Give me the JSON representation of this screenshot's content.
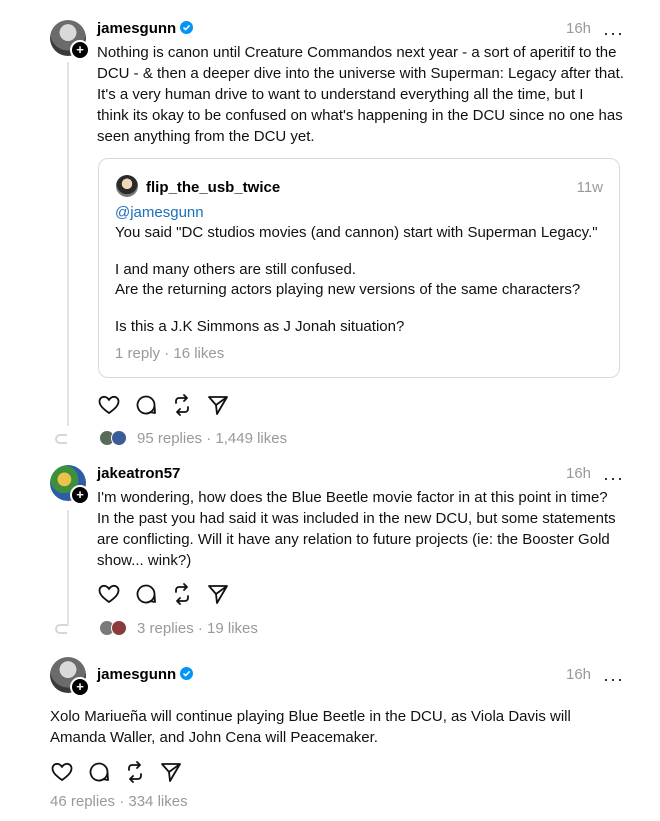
{
  "posts": [
    {
      "username": "jamesgunn",
      "time": "16h",
      "body": [
        "Nothing is canon until Creature Commandos next year - a sort of aperitif to the",
        "DCU - & then a deeper dive into the universe with Superman: Legacy after that.",
        "It's a very human drive to want to understand everything all the time, but I",
        "think its okay to be confused on what's happening in the DCU since no one has",
        "seen anything from the DCU yet."
      ],
      "quote": {
        "username": "flip_the_usb_twice",
        "time": "11w",
        "mention": "@jamesgunn",
        "lines": [
          "You said \"DC studios movies (and cannon) start with Superman Legacy.\"",
          "I and many others are still confused.",
          "Are the returning actors playing new versions of the same characters?",
          "Is this a J.K Simmons as J Jonah situation?"
        ],
        "stats": "1 reply · 16 likes"
      },
      "stats": "95 replies · 1,449 likes"
    },
    {
      "username": "jakeatron57",
      "time": "16h",
      "body": [
        "I'm wondering, how does the Blue Beetle movie factor in at this point in time?",
        "In the past you had said it was included in the new DCU, but some statements",
        "are conflicting. Will it have any relation to future projects (ie: the Booster Gold",
        "show... wink?)"
      ],
      "stats": "3 replies · 19 likes"
    },
    {
      "username": "jamesgunn",
      "time": "16h",
      "body": [
        "Xolo Mariueña will continue playing Blue Beetle in the DCU, as Viola Davis will",
        "Amanda Waller, and John Cena will Peacemaker."
      ],
      "stats": "46 replies · 334 likes"
    }
  ],
  "more_label": "···",
  "follow_label": "+",
  "colors": {
    "verified": "#0095f6",
    "mention": "#1d6fb8",
    "muted": "#999999"
  }
}
